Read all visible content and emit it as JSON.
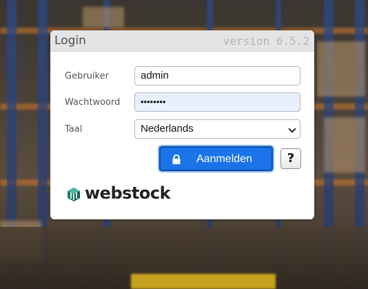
{
  "dialog": {
    "title": "Login",
    "version": "version 6.5.2"
  },
  "form": {
    "user_label": "Gebruiker",
    "user_value": "admin",
    "password_label": "Wachtwoord",
    "password_value": "••••••••",
    "language_label": "Taal",
    "language_value": "Nederlands"
  },
  "buttons": {
    "login_label": "Aanmelden",
    "login_icon": "lock-icon",
    "help_label": "?"
  },
  "brand": {
    "name": "webstock",
    "logo_icon": "webstock-logo-icon"
  },
  "colors": {
    "primary_button": "#1a73e8",
    "autofill_bg": "#e8f0fe",
    "header_bg": "#e4e4e4"
  }
}
